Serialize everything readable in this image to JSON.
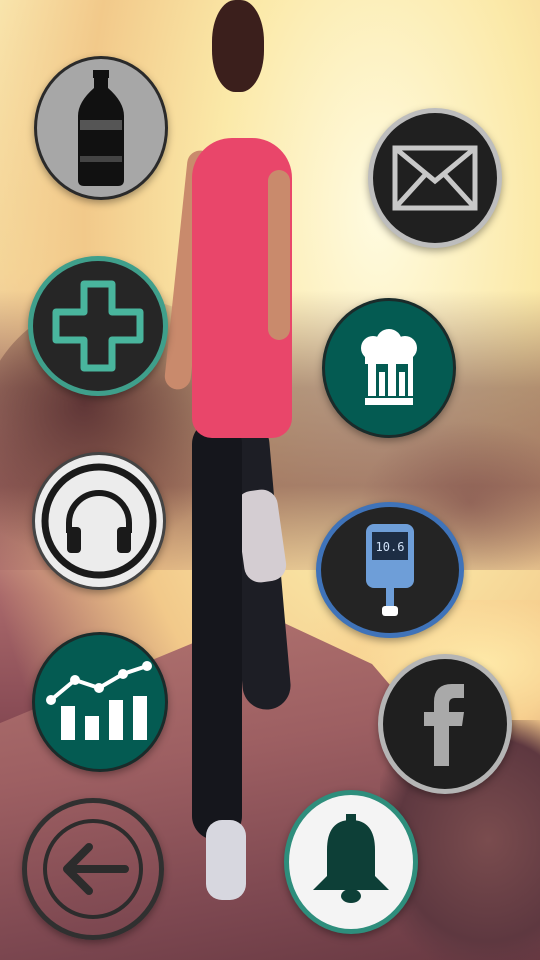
{
  "screen": {
    "background": "runner-at-sunset-photo"
  },
  "buttons": [
    {
      "id": "water",
      "icon": "bottle-icon",
      "accent": "#a7a7a7"
    },
    {
      "id": "messages",
      "icon": "envelope-icon",
      "accent": "#bdbdbd"
    },
    {
      "id": "health",
      "icon": "medical-cross-icon",
      "accent": "#3f9f8b"
    },
    {
      "id": "recipes",
      "icon": "chef-hat-icon",
      "accent": "#045b52"
    },
    {
      "id": "music",
      "icon": "headphones-icon",
      "accent": "#ececec"
    },
    {
      "id": "glucose",
      "icon": "glucose-meter-icon",
      "accent": "#3f73b9",
      "meter_reading": "10.6"
    },
    {
      "id": "stats",
      "icon": "chart-icon",
      "accent": "#045b52"
    },
    {
      "id": "facebook",
      "icon": "facebook-icon",
      "accent": "#b5b5b5"
    },
    {
      "id": "back",
      "icon": "arrow-left-icon",
      "accent": "#303030"
    },
    {
      "id": "reminders",
      "icon": "bell-icon",
      "accent": "#2e8e7c"
    }
  ]
}
